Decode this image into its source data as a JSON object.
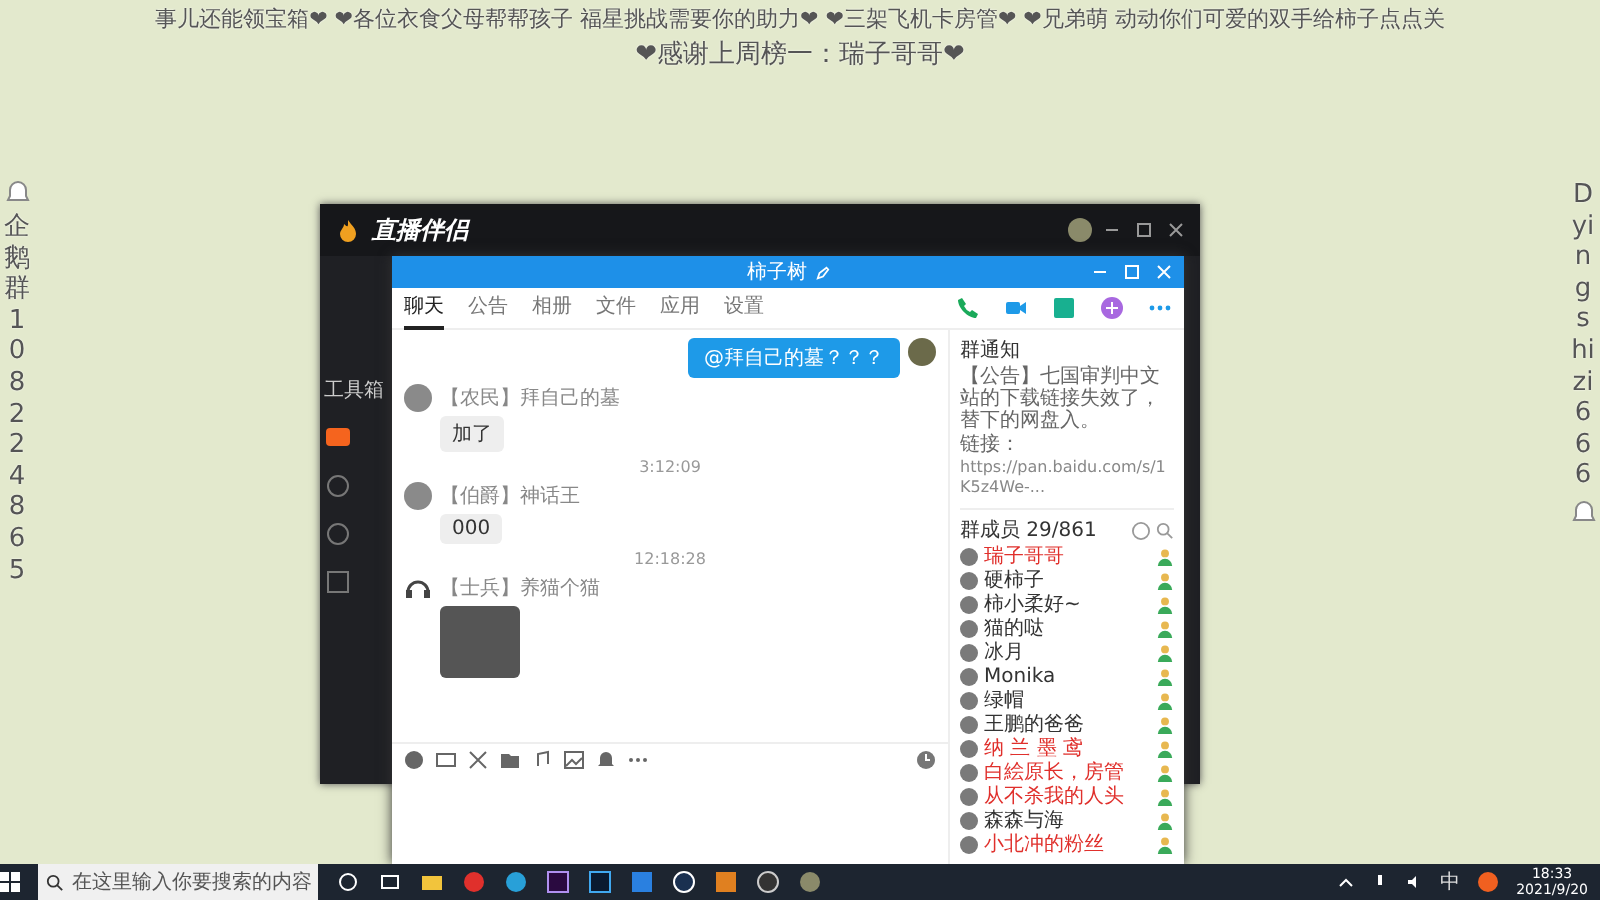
{
  "banner": {
    "lines": [
      "事儿还能领宝箱❤ ❤各位衣食父母帮帮孩子 福星挑战需要你的助力❤ ❤三架飞机卡房管❤ ❤兄弟萌 动动你们可爱的双手给柿子点点关",
      "❤感谢上周榜一：瑞子哥哥❤"
    ]
  },
  "side_left": {
    "text": "企鹅群108224865"
  },
  "side_right": {
    "text": "Dyingshizi666"
  },
  "streaming_app": {
    "title": "直播伴侣",
    "sidebar_label": "工具箱"
  },
  "chat_window": {
    "title": "柿子树",
    "tabs": [
      {
        "label": "聊天",
        "selected": true
      },
      {
        "label": "公告",
        "selected": false
      },
      {
        "label": "相册",
        "selected": false
      },
      {
        "label": "文件",
        "selected": false
      },
      {
        "label": "应用",
        "selected": false
      },
      {
        "label": "设置",
        "selected": false
      }
    ],
    "messages": [
      {
        "kind": "outgoing",
        "text": "@拜自己的墓？？？"
      },
      {
        "kind": "incoming",
        "sender": "【农民】拜自己的墓",
        "text": "加了"
      },
      {
        "kind": "time",
        "text": "3:12:09"
      },
      {
        "kind": "incoming",
        "sender": "【伯爵】神话王",
        "text": "000"
      },
      {
        "kind": "time",
        "text": "12:18:28"
      },
      {
        "kind": "sticker",
        "sender": "【士兵】养猫个猫"
      }
    ],
    "notice": {
      "title": "群通知",
      "text": "【公告】七国审判中文站的下载链接失效了，替下的网盘入。",
      "link_label": "链接：",
      "link": "https://pan.baidu.com/s/1K5z4We-..."
    },
    "members": {
      "title": "群成员 29/861",
      "items": [
        {
          "name": "瑞子哥哥",
          "color": "#e0302c"
        },
        {
          "name": "硬柿子",
          "color": "#333333"
        },
        {
          "name": "柿小柔好~",
          "color": "#333333"
        },
        {
          "name": "猫的哒",
          "color": "#333333"
        },
        {
          "name": "冰月",
          "color": "#333333"
        },
        {
          "name": "Monika",
          "color": "#333333"
        },
        {
          "name": "绿帽",
          "color": "#333333"
        },
        {
          "name": "王鹏的爸爸",
          "color": "#333333"
        },
        {
          "name": "纳 兰 墨 鸢",
          "color": "#e0302c"
        },
        {
          "name": "白絵原长，房管",
          "color": "#e0302c"
        },
        {
          "name": "从不杀我的人头",
          "color": "#e0302c"
        },
        {
          "name": "森森与海",
          "color": "#333333"
        },
        {
          "name": "小北冲的粉丝",
          "color": "#e0302c"
        }
      ]
    }
  },
  "taskbar": {
    "search_placeholder": "在这里输入你要搜索的内容",
    "ime": "中",
    "time": "18:33",
    "date": "2021/9/20"
  }
}
